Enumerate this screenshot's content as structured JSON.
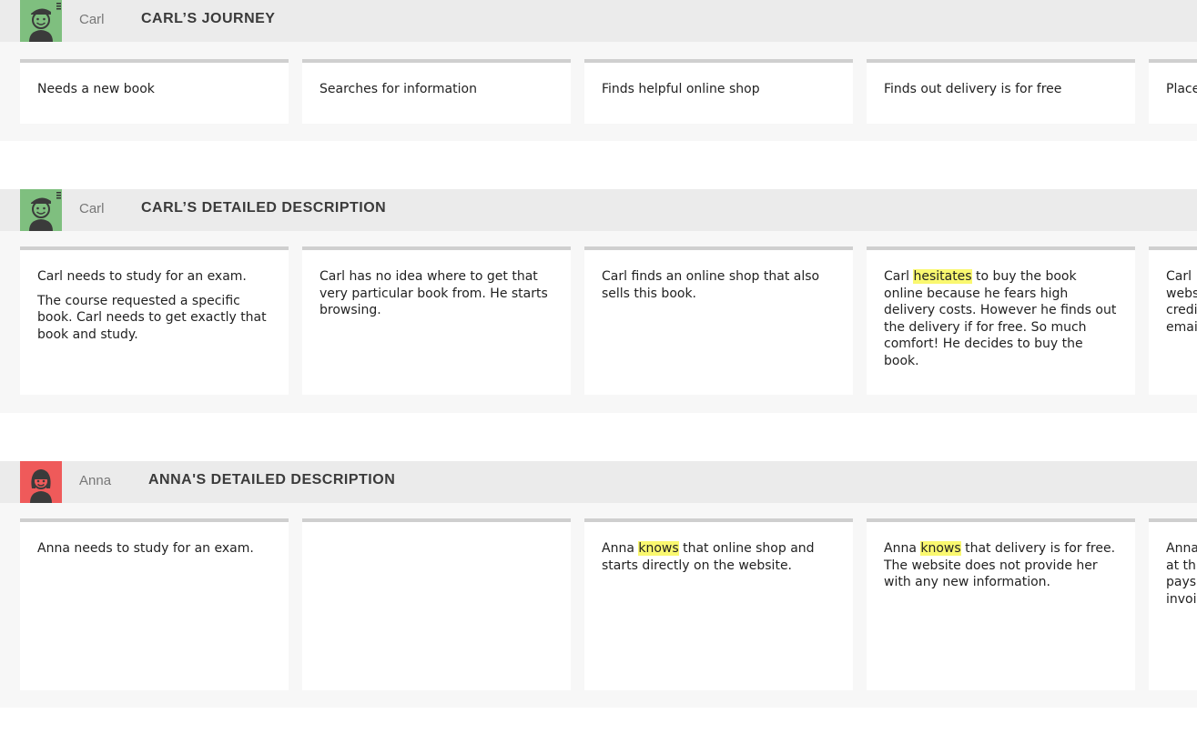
{
  "colors": {
    "carl_avatar": "#7fbf7f",
    "anna_avatar": "#ef5a5a",
    "highlight": "#faf870"
  },
  "lanes": [
    {
      "persona": "Carl",
      "avatar_icon": "boy-cap-icon",
      "title": "CARL’S JOURNEY",
      "cards": [
        {
          "text": [
            "Needs a new book"
          ]
        },
        {
          "text": [
            "Searches for information"
          ]
        },
        {
          "text": [
            "Finds helpful online shop"
          ]
        },
        {
          "text": [
            "Finds out delivery is for free"
          ]
        },
        {
          "text": [
            "Place"
          ]
        }
      ]
    },
    {
      "persona": "Carl",
      "avatar_icon": "boy-cap-icon",
      "title": "CARL’S DETAILED DESCRIPTION",
      "cards": [
        {
          "text": [
            "Carl needs to study for an exam.",
            "The course requested a specific book. Carl needs to get exactly that book and study."
          ]
        },
        {
          "text": [
            "Carl has no idea where to get that very particular book from. He starts browsing."
          ]
        },
        {
          "text": [
            "Carl finds an online shop that also sells this book."
          ]
        },
        {
          "pre": "Carl ",
          "highlight": "hesitates",
          "post": " to buy the book online because he fears high delivery costs. However he finds out the delivery if for free. So much comfort! He decides to buy the book."
        },
        {
          "text": [
            "Carl webs credi emai"
          ]
        }
      ]
    },
    {
      "persona": "Anna",
      "avatar_icon": "girl-pigtails-icon",
      "title": "ANNA'S DETAILED DESCRIPTION",
      "cards": [
        {
          "text": [
            "Anna needs to study for an exam."
          ]
        },
        {
          "text": [
            ""
          ]
        },
        {
          "pre": "Anna ",
          "highlight": "knows",
          "post": " that online shop and starts directly on the website."
        },
        {
          "pre": "Anna ",
          "highlight": "knows",
          "post": " that delivery is for free. The website does not provide her with any new information."
        },
        {
          "text": [
            "Anna at th pays invoi"
          ]
        }
      ]
    }
  ]
}
